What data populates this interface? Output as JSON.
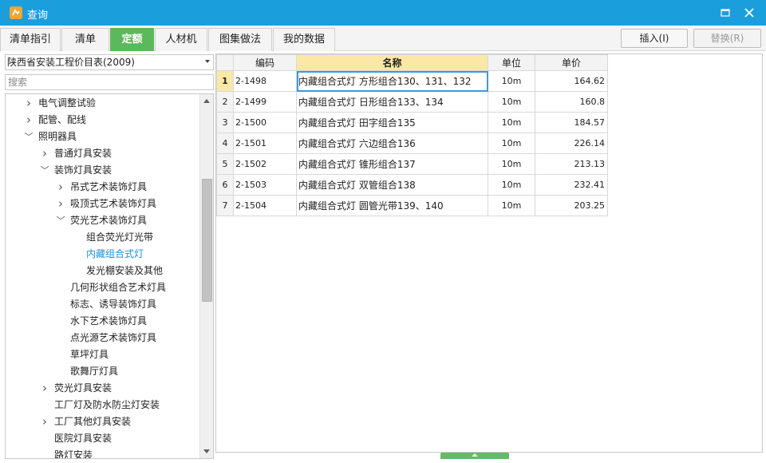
{
  "window": {
    "title": "查询"
  },
  "tabs": [
    {
      "label": "清单指引",
      "active": false
    },
    {
      "label": "清单",
      "active": false
    },
    {
      "label": "定额",
      "active": true
    },
    {
      "label": "人材机",
      "active": false
    },
    {
      "label": "图集做法",
      "active": false
    },
    {
      "label": "我的数据",
      "active": false
    }
  ],
  "actions": {
    "insert_label": "插入(I)",
    "replace_label": "替换(R)"
  },
  "catalog": {
    "selected": "陕西省安装工程价目表(2009)"
  },
  "search": {
    "placeholder": "搜索",
    "value": ""
  },
  "tree": {
    "nodes": [
      {
        "label": "电气调整试验",
        "level": 0,
        "caret": "collapsed",
        "selected": false
      },
      {
        "label": "配管、配线",
        "level": 0,
        "caret": "collapsed",
        "selected": false
      },
      {
        "label": "照明器具",
        "level": 0,
        "caret": "expanded",
        "selected": false
      },
      {
        "label": "普通灯具安装",
        "level": 1,
        "caret": "collapsed",
        "selected": false
      },
      {
        "label": "装饰灯具安装",
        "level": 1,
        "caret": "expanded",
        "selected": false
      },
      {
        "label": "吊式艺术装饰灯具",
        "level": 2,
        "caret": "collapsed",
        "selected": false
      },
      {
        "label": "吸顶式艺术装饰灯具",
        "level": 2,
        "caret": "collapsed",
        "selected": false
      },
      {
        "label": "荧光艺术装饰灯具",
        "level": 2,
        "caret": "expanded",
        "selected": false
      },
      {
        "label": "组合荧光灯光带",
        "level": 3,
        "caret": "none",
        "selected": false
      },
      {
        "label": "内藏组合式灯",
        "level": 3,
        "caret": "none",
        "selected": true
      },
      {
        "label": "发光棚安装及其他",
        "level": 3,
        "caret": "none",
        "selected": false
      },
      {
        "label": "几何形状组合艺术灯具",
        "level": 2,
        "caret": "none",
        "selected": false
      },
      {
        "label": "标志、诱导装饰灯具",
        "level": 2,
        "caret": "none",
        "selected": false
      },
      {
        "label": "水下艺术装饰灯具",
        "level": 2,
        "caret": "none",
        "selected": false
      },
      {
        "label": "点光源艺术装饰灯具",
        "level": 2,
        "caret": "none",
        "selected": false
      },
      {
        "label": "草坪灯具",
        "level": 2,
        "caret": "none",
        "selected": false
      },
      {
        "label": "歌舞厅灯具",
        "level": 2,
        "caret": "none",
        "selected": false
      },
      {
        "label": "荧光灯具安装",
        "level": 1,
        "caret": "collapsed",
        "selected": false
      },
      {
        "label": "工厂灯及防水防尘灯安装",
        "level": 1,
        "caret": "none",
        "selected": false
      },
      {
        "label": "工厂其他灯具安装",
        "level": 1,
        "caret": "collapsed",
        "selected": false
      },
      {
        "label": "医院灯具安装",
        "level": 1,
        "caret": "none",
        "selected": false
      },
      {
        "label": "路灯安装",
        "level": 1,
        "caret": "none",
        "selected": false
      }
    ]
  },
  "grid": {
    "headers": {
      "code": "编码",
      "name": "名称",
      "unit": "单位",
      "price": "单价"
    },
    "current_row": 1,
    "rows": [
      {
        "num": "1",
        "code": "2-1498",
        "name": "内藏组合式灯 方形组合130、131、132",
        "unit": "10m",
        "price": "164.62"
      },
      {
        "num": "2",
        "code": "2-1499",
        "name": "内藏组合式灯 日形组合133、134",
        "unit": "10m",
        "price": "160.8"
      },
      {
        "num": "3",
        "code": "2-1500",
        "name": "内藏组合式灯 田字组合135",
        "unit": "10m",
        "price": "184.57"
      },
      {
        "num": "4",
        "code": "2-1501",
        "name": "内藏组合式灯 六边组合136",
        "unit": "10m",
        "price": "226.14"
      },
      {
        "num": "5",
        "code": "2-1502",
        "name": "内藏组合式灯 锥形组合137",
        "unit": "10m",
        "price": "213.13"
      },
      {
        "num": "6",
        "code": "2-1503",
        "name": "内藏组合式灯 双管组合138",
        "unit": "10m",
        "price": "232.41"
      },
      {
        "num": "7",
        "code": "2-1504",
        "name": "内藏组合式灯 圆管光带139、140",
        "unit": "10m",
        "price": "203.25"
      }
    ]
  },
  "colors": {
    "titlebar": "#1b9fdc",
    "active_tab": "#5cb85c",
    "selected_text": "#1e8fe0",
    "header_highlight": "#fbe8a6"
  }
}
